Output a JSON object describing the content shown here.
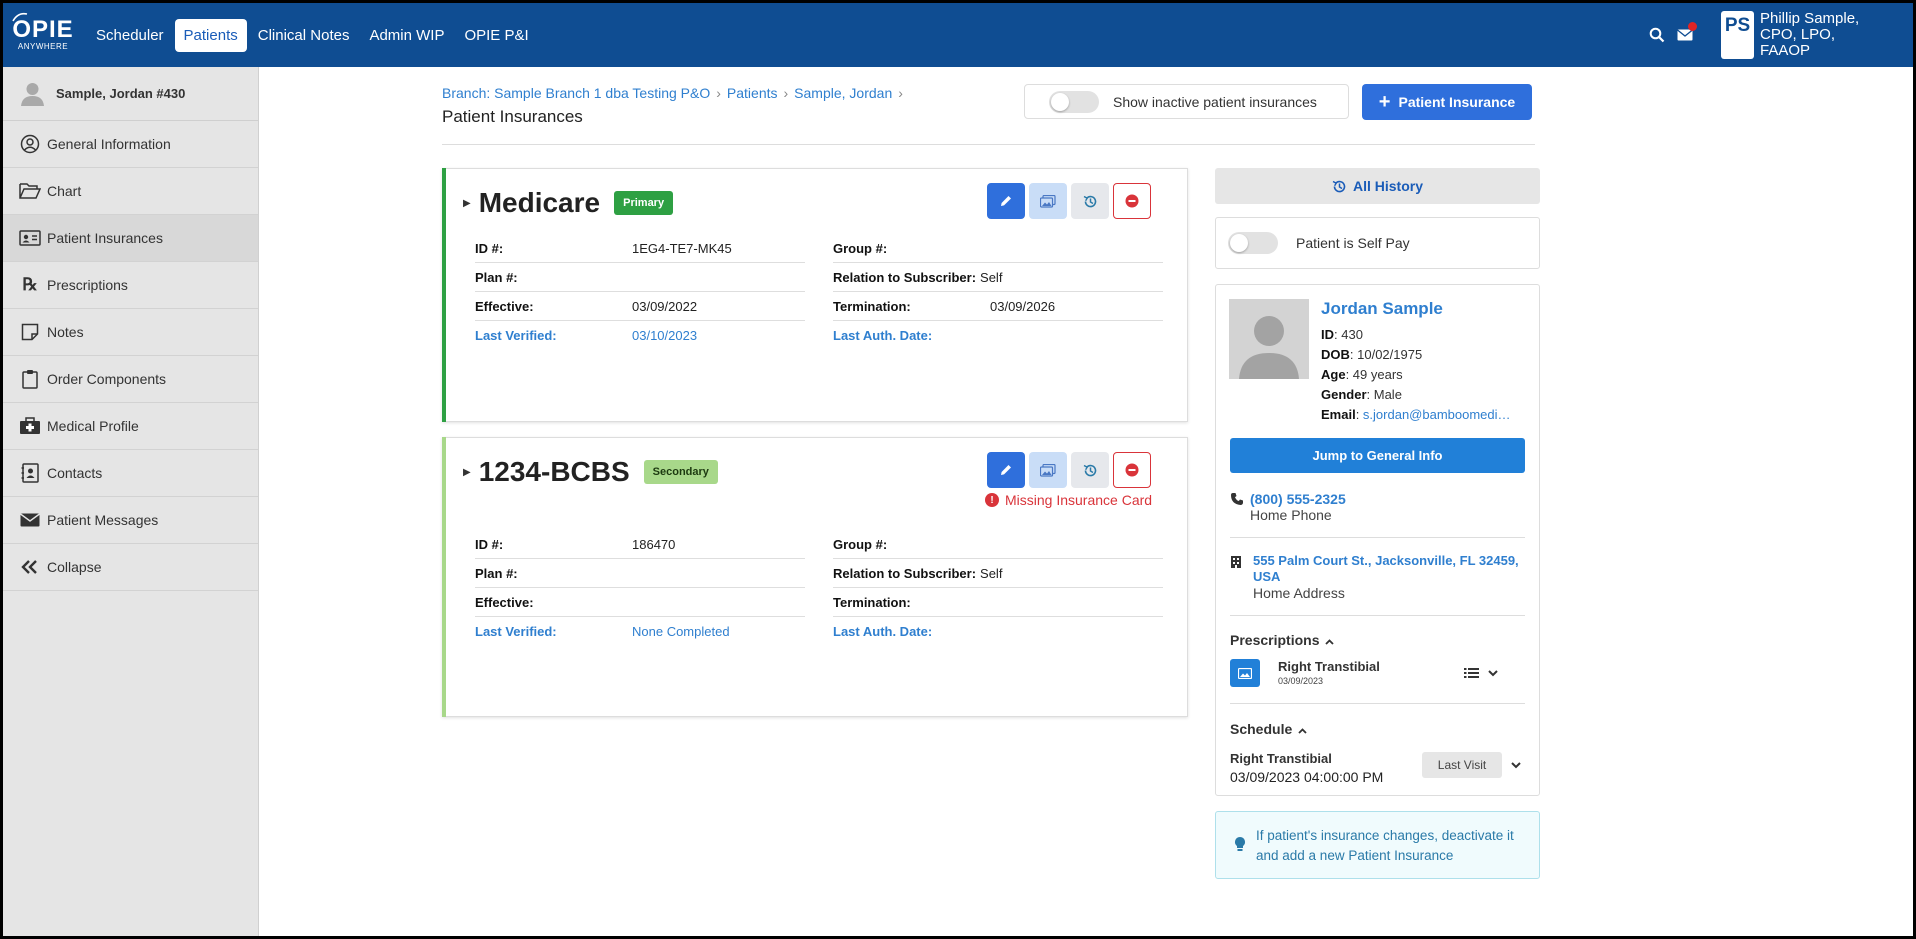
{
  "topbar": {
    "logo_text": "OPIE",
    "logo_sub": "ANYWHERE",
    "nav": [
      {
        "label": "Scheduler"
      },
      {
        "label": "Patients"
      },
      {
        "label": "Clinical Notes"
      },
      {
        "label": "Admin WIP"
      },
      {
        "label": "OPIE P&I"
      }
    ],
    "active_nav": "Patients",
    "user_initials": "PS",
    "user_name": "Phillip Sample, CPO, LPO, FAAOP",
    "has_notification": true
  },
  "sidebar": {
    "patient": "Sample, Jordan #430",
    "items": [
      {
        "label": "General Information",
        "icon": "user-circle-icon"
      },
      {
        "label": "Chart",
        "icon": "folder-open-icon"
      },
      {
        "label": "Patient Insurances",
        "icon": "id-card-icon"
      },
      {
        "label": "Prescriptions",
        "icon": "rx-icon"
      },
      {
        "label": "Notes",
        "icon": "note-icon"
      },
      {
        "label": "Order Components",
        "icon": "clipboard-icon"
      },
      {
        "label": "Medical Profile",
        "icon": "medical-bag-icon"
      },
      {
        "label": "Contacts",
        "icon": "contact-book-icon"
      },
      {
        "label": "Patient Messages",
        "icon": "envelope-icon"
      },
      {
        "label": "Collapse",
        "icon": "double-chevron-left-icon"
      }
    ],
    "active": "Patient Insurances"
  },
  "main": {
    "breadcrumb": [
      "Branch: Sample Branch 1 dba Testing P&O",
      "Patients",
      "Sample, Jordan"
    ],
    "title": "Patient Insurances",
    "show_inactive_label": "Show inactive patient insurances",
    "add_button": "Patient Insurance",
    "insurances": [
      {
        "name": "Medicare",
        "tag": "Primary",
        "tag_color": "#2ea043",
        "bar_color": "#2ea043",
        "warning": "",
        "id_label": "ID #:",
        "id": "1EG4-TE7-MK45",
        "group_label": "Group #:",
        "group": "",
        "plan_label": "Plan #:",
        "plan": "",
        "relation_label": "Relation to Subscriber:",
        "relation": "Self",
        "effective_label": "Effective:",
        "effective": "03/09/2022",
        "termination_label": "Termination:",
        "termination": "03/09/2026",
        "verified_label": "Last Verified:",
        "verified": "03/10/2023",
        "auth_label": "Last Auth. Date:",
        "auth": ""
      },
      {
        "name": "1234-BCBS",
        "tag": "Secondary",
        "tag_color": "#a8d88a",
        "bar_color": "#a8d88a",
        "warning": "Missing Insurance Card",
        "id_label": "ID #:",
        "id": "186470",
        "group_label": "Group #:",
        "group": "",
        "plan_label": "Plan #:",
        "plan": "",
        "relation_label": "Relation to Subscriber:",
        "relation": "Self",
        "effective_label": "Effective:",
        "effective": "",
        "termination_label": "Termination:",
        "termination": "",
        "verified_label": "Last Verified:",
        "verified": "None Completed",
        "auth_label": "Last Auth. Date:",
        "auth": ""
      }
    ]
  },
  "right_panel": {
    "all_history": "All History",
    "self_pay_label": "Patient is Self Pay",
    "patient": {
      "name": "Jordan Sample",
      "id_label": "ID",
      "id": "430",
      "dob_label": "DOB",
      "dob": "10/02/1975",
      "age_label": "Age",
      "age": "49 years",
      "gender_label": "Gender",
      "gender": "Male",
      "email_label": "Email",
      "email": "s.jordan@bamboomedical.com"
    },
    "jump_button": "Jump to General Info",
    "phone": "(800) 555-2325",
    "phone_type": "Home Phone",
    "address": "555 Palm Court St., Jacksonville, FL 32459, USA",
    "address_type": "Home Address",
    "prescriptions_label": "Prescriptions",
    "prescription": {
      "title": "Right Transtibial",
      "date": "03/09/2023"
    },
    "schedule_label": "Schedule",
    "schedule": {
      "title": "Right Transtibial",
      "datetime": "03/09/2023 04:00:00 PM",
      "button": "Last Visit"
    },
    "tip": "If patient's insurance changes, deactivate it and add a new Patient Insurance"
  }
}
